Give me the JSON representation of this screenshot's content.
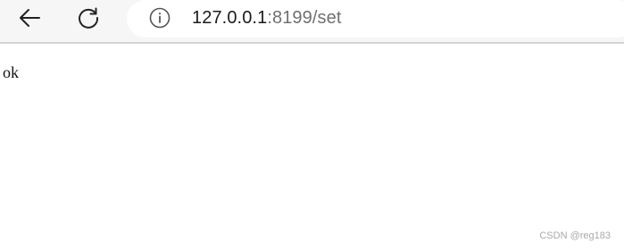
{
  "browser": {
    "back_icon": "arrow-left-icon",
    "reload_icon": "reload-icon",
    "info_icon": "info-icon",
    "address": {
      "host": "127.0.0.1",
      "rest": ":8199/set"
    }
  },
  "page": {
    "body_text": "ok"
  },
  "watermark": {
    "text": "CSDN @reg183"
  }
}
